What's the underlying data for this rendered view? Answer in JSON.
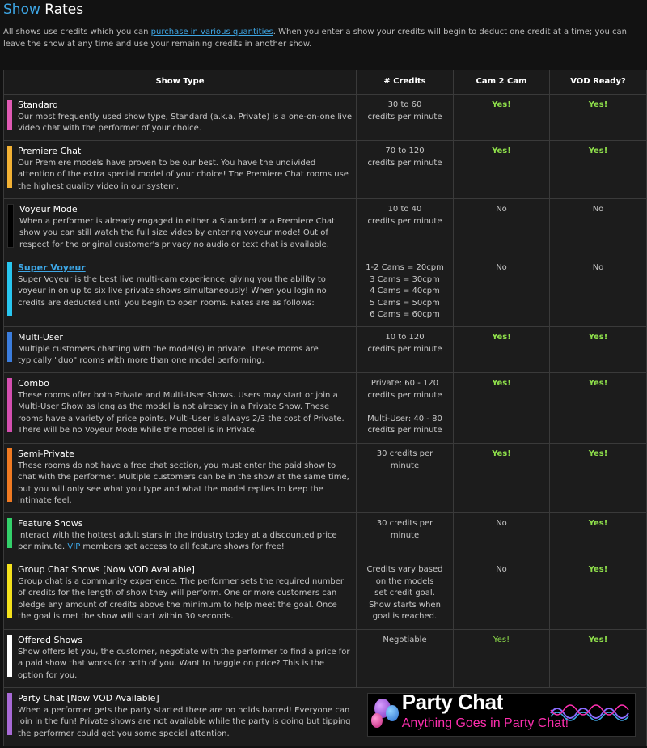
{
  "title": {
    "accent": "Show",
    "rest": " Rates"
  },
  "intro": {
    "before": "All shows use credits which you can ",
    "link": "purchase in various quantities",
    "after": ". When you enter a show your credits will begin to deduct one credit at a time; you can leave the show at any time and use your remaining credits in another show."
  },
  "headers": {
    "type": "Show Type",
    "credits": "# Credits",
    "cam2cam": "Cam 2 Cam",
    "vod": "VOD Ready?"
  },
  "rows": [
    {
      "name": "Standard",
      "color": "#e05ab4",
      "desc": "Our most frequently used show type, Standard (a.k.a. Private) is a one-on-one live video chat with the performer of your choice.",
      "credits": [
        "30 to 60",
        "credits per minute"
      ],
      "cam2cam": "Yes!",
      "vod": "Yes!"
    },
    {
      "name": "Premiere Chat",
      "color": "#f2b134",
      "desc": "Our Premiere models have proven to be our best. You have the undivided attention of the extra special model of your choice! The Premiere Chat rooms use the highest quality video in our system.",
      "credits": [
        "70 to 120",
        "credits per minute"
      ],
      "cam2cam": "Yes!",
      "vod": "Yes!"
    },
    {
      "name": "Voyeur Mode",
      "color": "#000000",
      "desc": "When a performer is already engaged in either a Standard or a Premiere Chat show you can still watch the full size video by entering voyeur mode! Out of respect for the original customer's privacy no audio or text chat is available.",
      "credits": [
        "10 to 40",
        "credits per minute"
      ],
      "cam2cam": "No",
      "vod": "No"
    },
    {
      "name": "Super Voyeur",
      "color": "#28c6f0",
      "desc": "Super Voyeur is the best live multi-cam experience, giving you the ability to voyeur in on up to six live private shows simultaneously! When you login no credits are deducted until you begin to open rooms. Rates are as follows:",
      "credits": [
        "1-2 Cams = 20cpm",
        "3 Cams = 30cpm",
        "4 Cams = 40cpm",
        "5 Cams = 50cpm",
        "6 Cams = 60cpm"
      ],
      "cam2cam": "No",
      "vod": "No"
    },
    {
      "name": "Multi-User",
      "color": "#3b7ddd",
      "desc": "Multiple customers chatting with the model(s) in private. These rooms are typically \"duo\" rooms with more than one model performing.",
      "credits": [
        "10 to 120",
        "credits per minute"
      ],
      "cam2cam": "Yes!",
      "vod": "Yes!"
    },
    {
      "name": "Combo",
      "color": "#d44fb0",
      "desc": "These rooms offer both Private and Multi-User Shows. Users may start or join a Multi-User Show as long as the model is not already in a Private Show. These rooms have a variety of price points. Multi-User is always 2/3 the cost of Private. There will be no Voyeur Mode while the model is in Private.",
      "credits": [
        "Private: 60 - 120",
        "credits per minute",
        "",
        "Multi-User: 40 - 80",
        "credits per minute"
      ],
      "cam2cam": "Yes!",
      "vod": "Yes!"
    },
    {
      "name": "Semi-Private",
      "color": "#f07a22",
      "desc": "These rooms do not have a free chat section, you must enter the paid show to chat with the performer. Multiple customers can be in the show at the same time, but you will only see what you type and what the model replies to keep the intimate feel.",
      "credits": [
        "30 credits per",
        "minute"
      ],
      "cam2cam": "Yes!",
      "vod": "Yes!"
    },
    {
      "name": "Feature Shows",
      "color": "#33d06a",
      "desc_before": "Interact with the hottest adult stars in the industry today at a discounted price per minute. ",
      "desc_link": "VIP",
      "desc_after": " members get access to all feature shows for free!",
      "credits": [
        "30 credits per",
        "minute"
      ],
      "cam2cam": "No",
      "vod": "Yes!"
    },
    {
      "name": "Group Chat Shows [Now VOD Available]",
      "color": "#f4e11c",
      "desc": "Group chat is a community experience. The performer sets the required number of credits for the length of show they will perform. One or more customers can pledge any amount of credits above the minimum to help meet the goal. Once the goal is met the show will start within 30 seconds.",
      "credits": [
        "Credits vary based",
        "on the models",
        "set credit goal.",
        "Show starts when",
        "goal is reached."
      ],
      "cam2cam": "No",
      "vod": "Yes!"
    },
    {
      "name": "Offered Shows",
      "color": "#ffffff",
      "desc": "Show offers let you, the customer, negotiate with the performer to find a price for a paid show that works for both of you. Want to haggle on price? This is the option for you.",
      "credits": [
        "Negotiable"
      ],
      "cam2cam": "Yes!",
      "vod": "Yes!"
    },
    {
      "name": "Party Chat [Now VOD Available]",
      "color": "#a86ad6",
      "desc": "When a performer gets the party started there are no holds barred! Everyone can join in the fun! Private shows are not available while the party is going but tipping the performer could get you some special attention.",
      "banner": {
        "title": "Party Chat",
        "subtitle": "Anything Goes in Party Chat!"
      }
    }
  ],
  "colors": {
    "accent": "#3ea7e6",
    "yes": "#8fe04b",
    "banner_pink": "#ff2fb0"
  }
}
